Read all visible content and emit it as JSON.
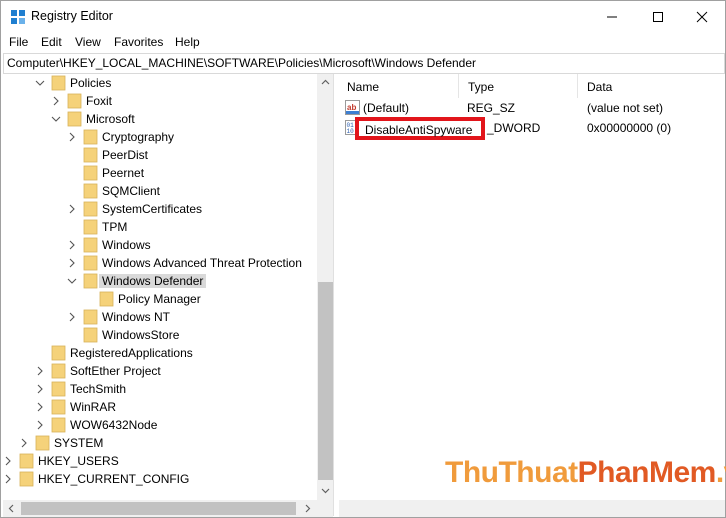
{
  "window": {
    "title": "Registry Editor"
  },
  "menu": [
    "File",
    "Edit",
    "View",
    "Favorites",
    "Help"
  ],
  "address": "Computer\\HKEY_LOCAL_MACHINE\\SOFTWARE\\Policies\\Microsoft\\Windows Defender",
  "tree": [
    {
      "label": "Policies",
      "expander": "open"
    },
    {
      "label": "Foxit",
      "expander": "closed"
    },
    {
      "label": "Microsoft",
      "expander": "open"
    },
    {
      "label": "Cryptography",
      "expander": "closed"
    },
    {
      "label": "PeerDist",
      "expander": "none"
    },
    {
      "label": "Peernet",
      "expander": "none"
    },
    {
      "label": "SQMClient",
      "expander": "none"
    },
    {
      "label": "SystemCertificates",
      "expander": "closed"
    },
    {
      "label": "TPM",
      "expander": "none"
    },
    {
      "label": "Windows",
      "expander": "closed"
    },
    {
      "label": "Windows Advanced Threat Protection",
      "expander": "closed"
    },
    {
      "label": "Windows Defender",
      "expander": "open",
      "selected": true
    },
    {
      "label": "Policy Manager",
      "expander": "none"
    },
    {
      "label": "Windows NT",
      "expander": "closed"
    },
    {
      "label": "WindowsStore",
      "expander": "none"
    },
    {
      "label": "RegisteredApplications",
      "expander": "none"
    },
    {
      "label": "SoftEther Project",
      "expander": "closed"
    },
    {
      "label": "TechSmith",
      "expander": "closed"
    },
    {
      "label": "WinRAR",
      "expander": "closed"
    },
    {
      "label": "WOW6432Node",
      "expander": "closed"
    },
    {
      "label": "SYSTEM",
      "expander": "closed"
    },
    {
      "label": "HKEY_USERS",
      "expander": "closed"
    },
    {
      "label": "HKEY_CURRENT_CONFIG",
      "expander": "closed"
    }
  ],
  "list": {
    "columns": [
      "Name",
      "Type",
      "Data"
    ],
    "rows": [
      {
        "name": "(Default)",
        "type": "REG_SZ",
        "data": "(value not set)",
        "icon": "string-value-icon"
      },
      {
        "name": "DisableAntiSpyware",
        "type": "REG_DWORD",
        "type_visible": "_DWORD",
        "data": "0x00000000 (0)",
        "icon": "dword-value-icon",
        "editing": true
      }
    ]
  },
  "highlight_color": "#e2151b",
  "watermark": {
    "part1": "ThuThuat",
    "part2": "PhanMem",
    "part3": ".vn"
  },
  "colors": {
    "folder": "#f5d27a",
    "selection": "#d9d9d9"
  }
}
